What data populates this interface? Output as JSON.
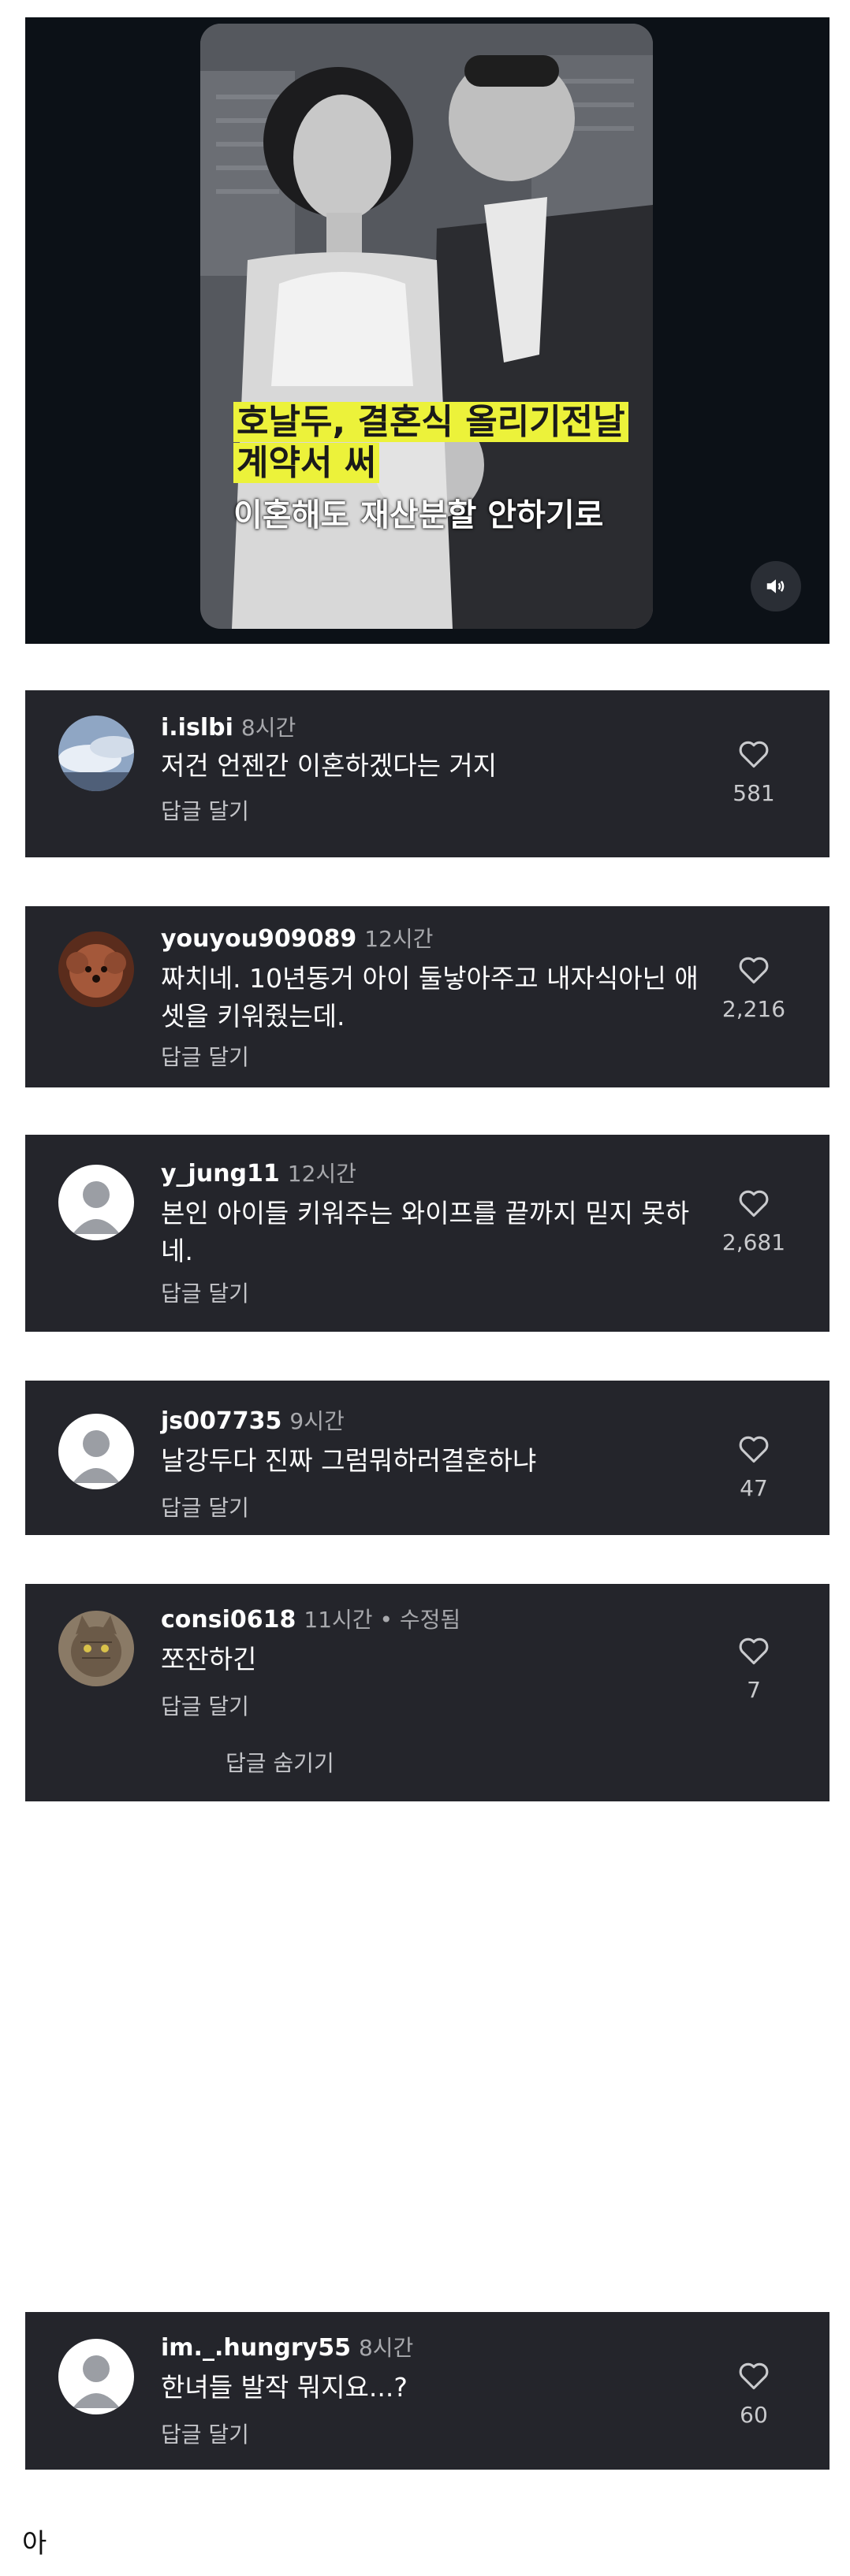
{
  "video": {
    "caption_line1": "호날두, 결혼식 올리기전날",
    "caption_line2": "계약서 써",
    "caption_sub": "이혼해도 재산분할 안하기로",
    "mute_icon": "speaker-icon"
  },
  "comments": [
    {
      "username": "i.islbi",
      "time": "8시간",
      "text": "저건 언젠간 이혼하겠다는 거지",
      "reply_label": "답글 달기",
      "likes": "581",
      "avatar": "sky-photo"
    },
    {
      "username": "youyou909089",
      "time": "12시간",
      "text": "짜치네. 10년동거 아이 둘낳아주고 내자식아닌 애 셋을 키워줬는데.",
      "reply_label": "답글 달기",
      "likes": "2,216",
      "avatar": "dog-photo"
    },
    {
      "username": "y_jung11",
      "time": "12시간",
      "text": "본인 아이들 키워주는 와이프를 끝까지 믿지 못하네.",
      "reply_label": "답글 달기",
      "likes": "2,681",
      "avatar": "default-avatar"
    },
    {
      "username": "js007735",
      "time": "9시간",
      "text": "날강두다 진짜 그럼뭐하러결혼하냐",
      "reply_label": "답글 달기",
      "likes": "47",
      "avatar": "default-avatar"
    },
    {
      "username": "consi0618",
      "time": "11시간 • 수정됨",
      "text": "쪼잔하긴",
      "reply_label": "답글 달기",
      "likes": "7",
      "hide_replies_label": "답글 숨기기",
      "avatar": "cat-photo"
    },
    {
      "username": "im._.hungry55",
      "time": "8시간",
      "text": "한녀들 발작 뭐지요...?",
      "reply_label": "답글 달기",
      "likes": "60",
      "avatar": "default-avatar"
    }
  ],
  "footer": {
    "text": "아"
  },
  "colors": {
    "panel": "#24252b",
    "video_bg": "#0c1117",
    "caption_highlight": "#ecf23a"
  }
}
